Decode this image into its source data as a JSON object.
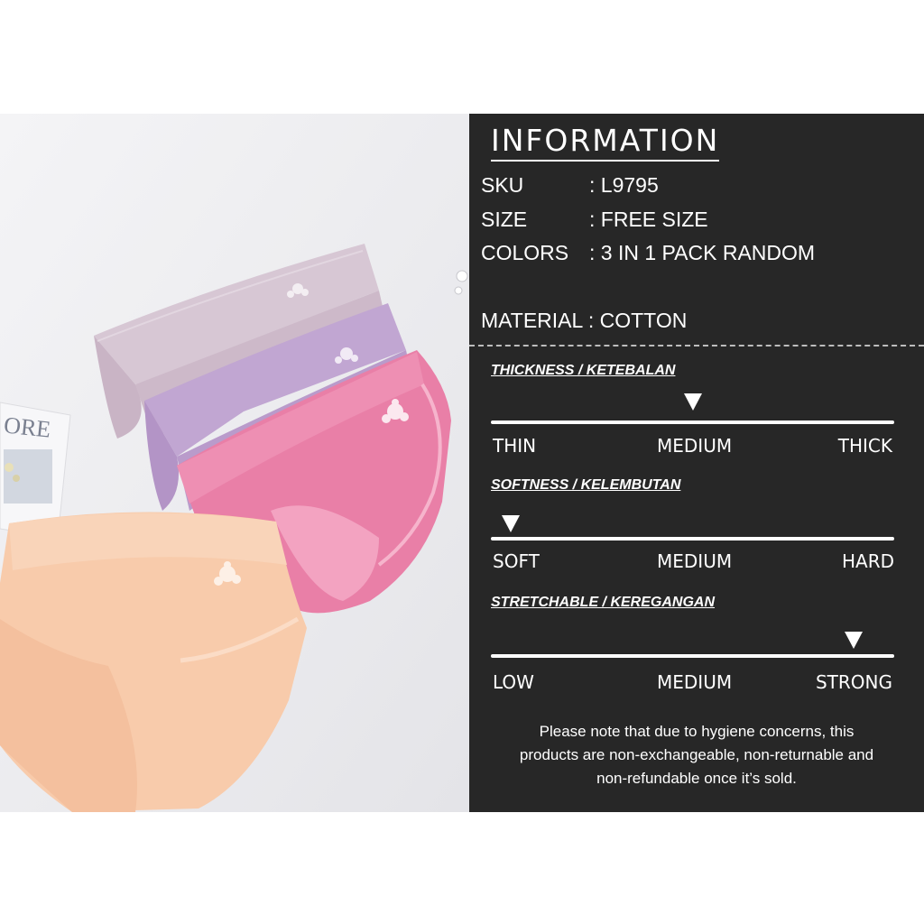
{
  "panel": {
    "title": "INFORMATION",
    "info": [
      {
        "label": "SKU",
        "value": ": L9795"
      },
      {
        "label": "SIZE",
        "value": ": FREE SIZE"
      },
      {
        "label": "COLORS",
        "value": ": 3 IN 1 PACK RANDOM"
      }
    ],
    "material": "MATERIAL : COTTON",
    "scales": [
      {
        "title": "THICKNESS / KETEBALAN",
        "low": "THIN",
        "mid": "MEDIUM",
        "high": "THICK",
        "level": 0.5
      },
      {
        "title": "SOFTNESS / KELEMBUTAN",
        "low": "SOFT",
        "mid": "MEDIUM",
        "high": "HARD",
        "level": 0.05
      },
      {
        "title": "STRETCHABLE / KEREGANGAN",
        "low": "LOW",
        "mid": "MEDIUM",
        "high": "STRONG",
        "level": 0.9
      }
    ],
    "note": {
      "line1": "Please note that due to hygiene concerns, this",
      "line2": "products are non-exchangeable, non-returnable and",
      "line3": "non-refundable once it’s sold."
    }
  },
  "photo": {
    "card_text": "ORE",
    "colors": {
      "background": "#ececee",
      "lilac": "#cbb7c8",
      "purple": "#b89ac9",
      "pink": "#e77aa3",
      "peach": "#f7c8a8"
    }
  }
}
